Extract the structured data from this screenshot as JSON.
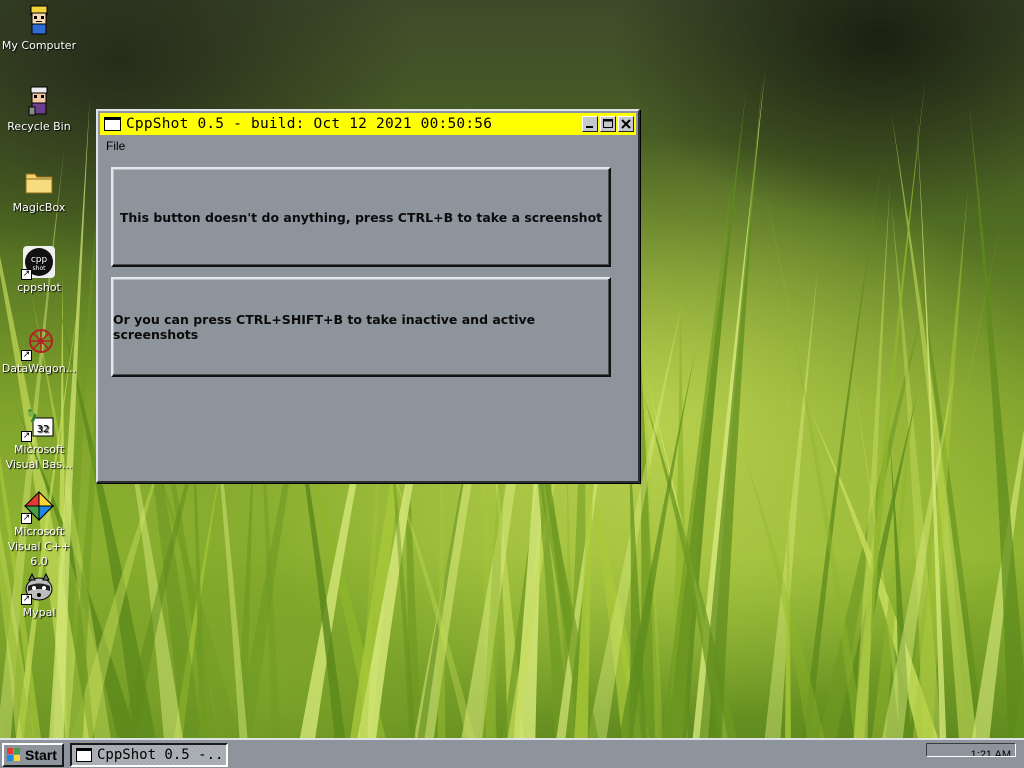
{
  "window": {
    "title": "CppShot 0.5 - build: Oct 12 2021 00:50:56",
    "menu": [
      "File"
    ],
    "button1_label": "This button doesn't do anything, press CTRL+B to take a screenshot",
    "button2_label": "Or you can press CTRL+SHIFT+B to take inactive and active screenshots",
    "titlebar_color": "#ffff00",
    "face_color": "#8e949b"
  },
  "desktop_icons": [
    {
      "label": "My Computer",
      "icon": "cartoon-character-icon"
    },
    {
      "label": "Recycle Bin",
      "icon": "cartoon-character-icon"
    },
    {
      "label": "MagicBox",
      "icon": "folder-icon"
    },
    {
      "label": "cppshot",
      "icon": "cppshot-app-icon",
      "shortcut": true
    },
    {
      "label": "DataWagon...",
      "icon": "wagon-wheel-icon",
      "shortcut": true
    },
    {
      "label": "Microsoft Visual Bas...",
      "icon": "visual-basic-icon",
      "shortcut": true
    },
    {
      "label": "Microsoft Visual C++ 6.0",
      "icon": "visual-cpp-icon",
      "shortcut": true
    },
    {
      "label": "Mypal",
      "icon": "raccoon-icon",
      "shortcut": true
    }
  ],
  "taskbar": {
    "start_label": "Start",
    "task_label": "CppShot 0.5 -...",
    "clock": "1:21 AM"
  }
}
